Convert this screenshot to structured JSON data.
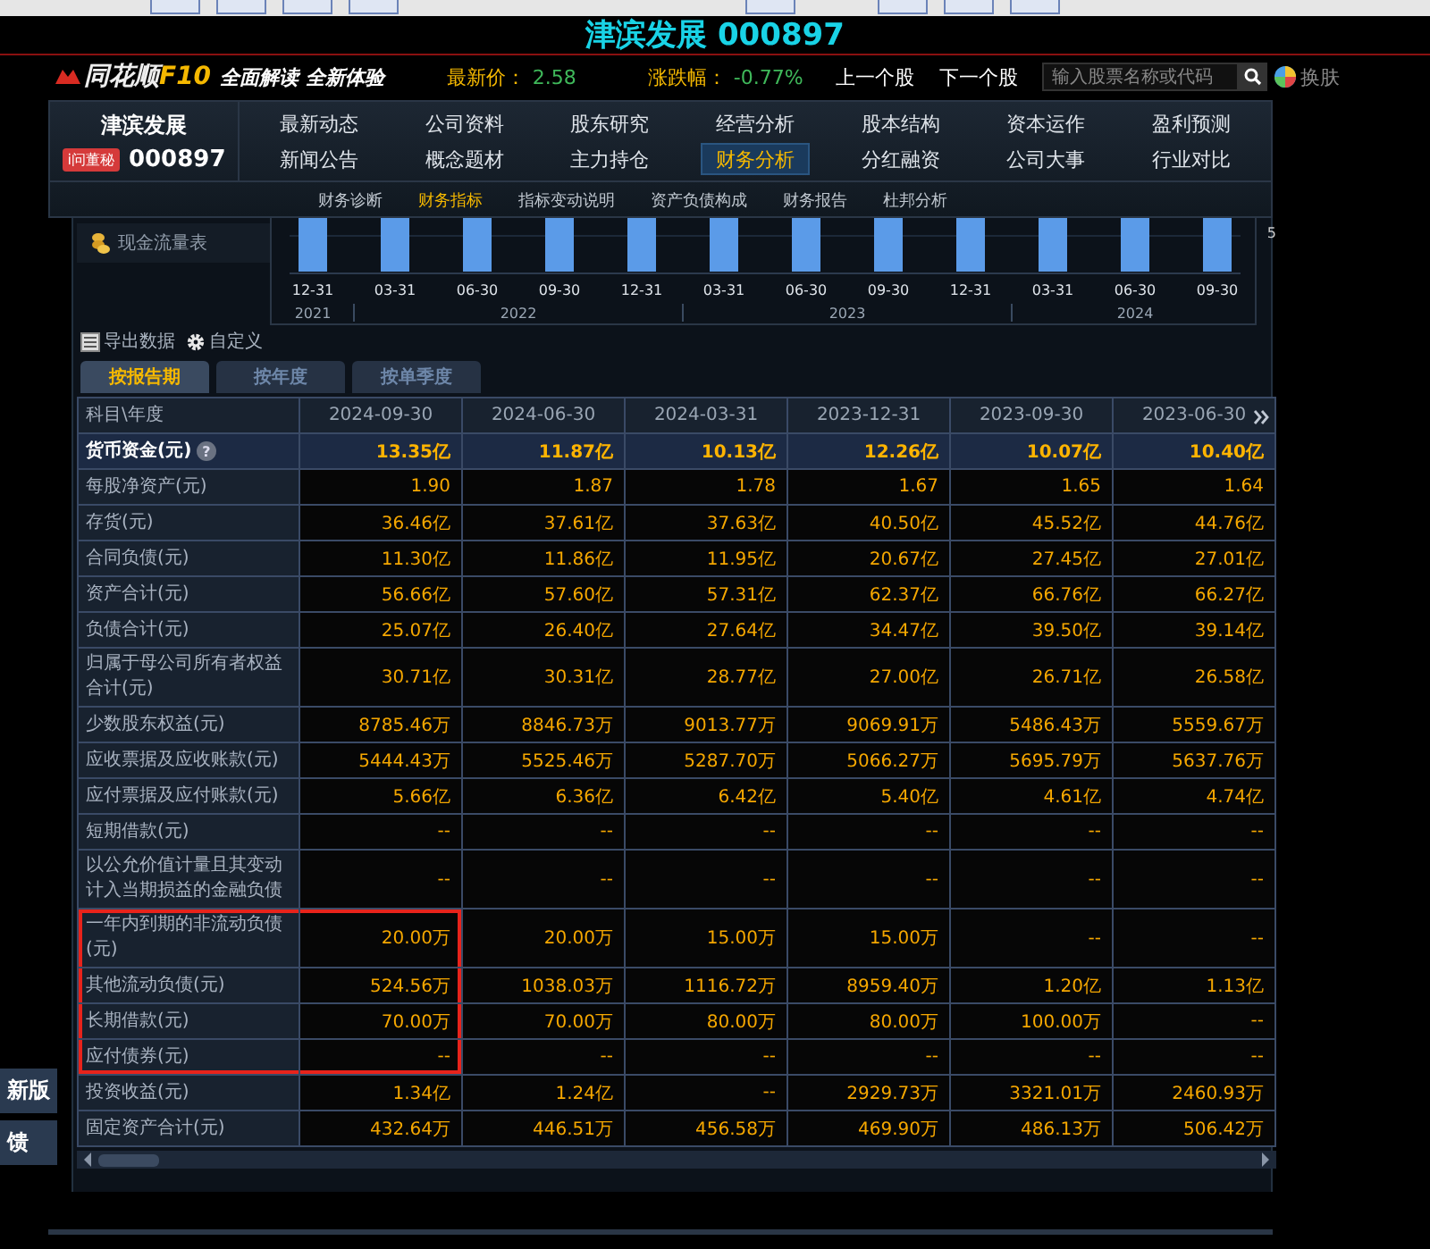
{
  "title": {
    "name": "津滨发展",
    "code": "000897"
  },
  "header": {
    "logo": "同花顺",
    "logo_suffix": "F10",
    "slogan": "全面解读 全新体验",
    "price_label": "最新价：",
    "price": "2.58",
    "change_label": "涨跌幅：",
    "change": "-0.77%",
    "prev": "上一个股",
    "next": "下一个股",
    "search_placeholder": "输入股票名称或代码",
    "skin": "换肤"
  },
  "stock": {
    "name": "津滨发展",
    "badge": "i问董秘",
    "code": "000897"
  },
  "nav": [
    {
      "label": "最新动态",
      "selected": false
    },
    {
      "label": "公司资料",
      "selected": false
    },
    {
      "label": "股东研究",
      "selected": false
    },
    {
      "label": "经营分析",
      "selected": false
    },
    {
      "label": "股本结构",
      "selected": false
    },
    {
      "label": "资本运作",
      "selected": false
    },
    {
      "label": "盈利预测",
      "selected": false
    },
    {
      "label": "新闻公告",
      "selected": false
    },
    {
      "label": "概念题材",
      "selected": false
    },
    {
      "label": "主力持仓",
      "selected": false
    },
    {
      "label": "财务分析",
      "selected": true
    },
    {
      "label": "分红融资",
      "selected": false
    },
    {
      "label": "公司大事",
      "selected": false
    },
    {
      "label": "行业对比",
      "selected": false
    }
  ],
  "subnav": [
    {
      "label": "财务诊断",
      "selected": false
    },
    {
      "label": "财务指标",
      "selected": true
    },
    {
      "label": "指标变动说明",
      "selected": false
    },
    {
      "label": "资产负债构成",
      "selected": false
    },
    {
      "label": "财务报告",
      "selected": false
    },
    {
      "label": "杜邦分析",
      "selected": false
    }
  ],
  "side_item": "现金流量表",
  "chart": {
    "axis_value": "5",
    "x_labels": [
      "12-31",
      "03-31",
      "06-30",
      "09-30",
      "12-31",
      "03-31",
      "06-30",
      "09-30",
      "12-31",
      "03-31",
      "06-30",
      "09-30"
    ],
    "years": [
      "2021",
      "2022",
      "2023",
      "2024"
    ]
  },
  "actions": [
    "导出数据",
    "自定义"
  ],
  "period_tabs": [
    {
      "label": "按报告期",
      "selected": true
    },
    {
      "label": "按年度",
      "selected": false
    },
    {
      "label": "按单季度",
      "selected": false
    }
  ],
  "table": {
    "corner": "科目\\年度",
    "help_mark": "?",
    "columns": [
      "2024-09-30",
      "2024-06-30",
      "2024-03-31",
      "2023-12-31",
      "2023-09-30",
      "2023-06-30"
    ],
    "rows": [
      {
        "label": "货币资金(元)",
        "selected": true,
        "boxed": false,
        "values": [
          "13.35亿",
          "11.87亿",
          "10.13亿",
          "12.26亿",
          "10.07亿",
          "10.40亿"
        ]
      },
      {
        "label": "每股净资产(元)",
        "selected": false,
        "boxed": false,
        "values": [
          "1.90",
          "1.87",
          "1.78",
          "1.67",
          "1.65",
          "1.64"
        ]
      },
      {
        "label": "存货(元)",
        "selected": false,
        "boxed": false,
        "values": [
          "36.46亿",
          "37.61亿",
          "37.63亿",
          "40.50亿",
          "45.52亿",
          "44.76亿"
        ]
      },
      {
        "label": "合同负债(元)",
        "selected": false,
        "boxed": false,
        "values": [
          "11.30亿",
          "11.86亿",
          "11.95亿",
          "20.67亿",
          "27.45亿",
          "27.01亿"
        ]
      },
      {
        "label": "资产合计(元)",
        "selected": false,
        "boxed": false,
        "values": [
          "56.66亿",
          "57.60亿",
          "57.31亿",
          "62.37亿",
          "66.76亿",
          "66.27亿"
        ]
      },
      {
        "label": "负债合计(元)",
        "selected": false,
        "boxed": false,
        "values": [
          "25.07亿",
          "26.40亿",
          "27.64亿",
          "34.47亿",
          "39.50亿",
          "39.14亿"
        ]
      },
      {
        "label": "归属于母公司所有者权益合计(元)",
        "selected": false,
        "boxed": false,
        "values": [
          "30.71亿",
          "30.31亿",
          "28.77亿",
          "27.00亿",
          "26.71亿",
          "26.58亿"
        ]
      },
      {
        "label": "少数股东权益(元)",
        "selected": false,
        "boxed": false,
        "values": [
          "8785.46万",
          "8846.73万",
          "9013.77万",
          "9069.91万",
          "5486.43万",
          "5559.67万"
        ]
      },
      {
        "label": "应收票据及应收账款(元)",
        "selected": false,
        "boxed": false,
        "values": [
          "5444.43万",
          "5525.46万",
          "5287.70万",
          "5066.27万",
          "5695.79万",
          "5637.76万"
        ]
      },
      {
        "label": "应付票据及应付账款(元)",
        "selected": false,
        "boxed": false,
        "values": [
          "5.66亿",
          "6.36亿",
          "6.42亿",
          "5.40亿",
          "4.61亿",
          "4.74亿"
        ]
      },
      {
        "label": "短期借款(元)",
        "selected": false,
        "boxed": false,
        "values": [
          "--",
          "--",
          "--",
          "--",
          "--",
          "--"
        ]
      },
      {
        "label": "以公允价值计量且其变动计入当期损益的金融负债",
        "selected": false,
        "boxed": false,
        "values": [
          "--",
          "--",
          "--",
          "--",
          "--",
          "--"
        ]
      },
      {
        "label": "一年内到期的非流动负债(元)",
        "selected": false,
        "boxed": true,
        "values": [
          "20.00万",
          "20.00万",
          "15.00万",
          "15.00万",
          "--",
          "--"
        ]
      },
      {
        "label": "其他流动负债(元)",
        "selected": false,
        "boxed": true,
        "values": [
          "524.56万",
          "1038.03万",
          "1116.72万",
          "8959.40万",
          "1.20亿",
          "1.13亿"
        ]
      },
      {
        "label": "长期借款(元)",
        "selected": false,
        "boxed": true,
        "values": [
          "70.00万",
          "70.00万",
          "80.00万",
          "80.00万",
          "100.00万",
          "--"
        ]
      },
      {
        "label": "应付债券(元)",
        "selected": false,
        "boxed": true,
        "values": [
          "--",
          "--",
          "--",
          "--",
          "--",
          "--"
        ]
      },
      {
        "label": "投资收益(元)",
        "selected": false,
        "boxed": false,
        "values": [
          "1.34亿",
          "1.24亿",
          "--",
          "2929.73万",
          "3321.01万",
          "2460.93万"
        ]
      },
      {
        "label": "固定资产合计(元)",
        "selected": false,
        "boxed": false,
        "values": [
          "432.64万",
          "446.51万",
          "456.58万",
          "469.90万",
          "486.13万",
          "506.42万"
        ]
      }
    ]
  },
  "side_buttons": [
    "新版",
    "馈"
  ]
}
